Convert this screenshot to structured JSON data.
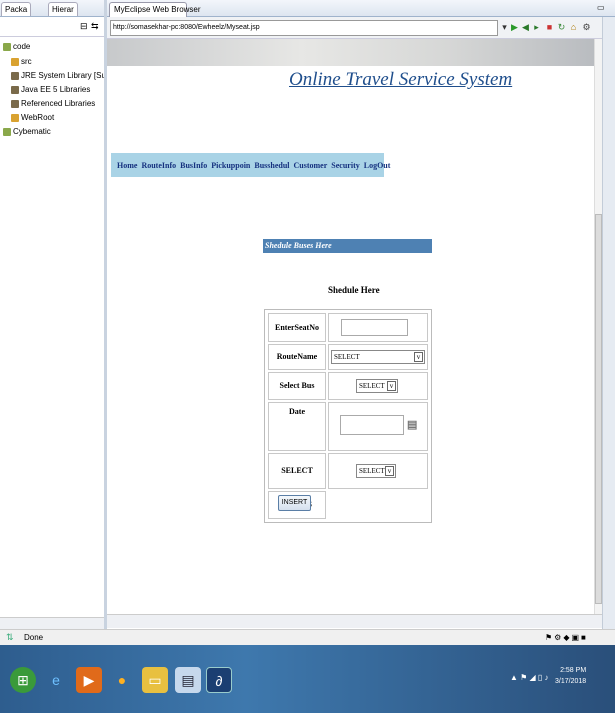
{
  "left_panel": {
    "tabs": [
      {
        "label": "Packa"
      },
      {
        "label": "Hierar"
      }
    ],
    "tree": [
      {
        "label": "code",
        "color": "#8aa84a"
      },
      {
        "label": "src",
        "color": "#d9a230"
      },
      {
        "label": "JRE System Library [Sun J",
        "color": "#7a6a4a"
      },
      {
        "label": "Java EE 5 Libraries",
        "color": "#7a6a4a"
      },
      {
        "label": "Referenced Libraries",
        "color": "#7a6a4a"
      },
      {
        "label": "WebRoot",
        "color": "#d9a230"
      },
      {
        "label": "Cybematic",
        "color": "#8aa84a"
      }
    ]
  },
  "browser": {
    "tab_label": "MyEclipse Web Browser",
    "url": "http://somasekhar-pc:8080/Ewheelz/Myseat.jsp"
  },
  "page": {
    "site_title": "Online Travel Service System",
    "nav": [
      "Home",
      "RouteInfo",
      "BusInfo",
      "Pickuppoin",
      "Busshedul",
      "Customer",
      "Security",
      "LogOut"
    ],
    "section_title": "Shedule Buses Here",
    "form_heading": "Shedule Here",
    "form": {
      "seat_label": "EnterSeatNo",
      "route_label": "RouteName",
      "route_value": "SELECT",
      "bus_label": "Select Bus",
      "bus_value": "SELECT",
      "date_label": "Date",
      "status_label": "SELECT STATUS",
      "status_value": "SELECT",
      "insert_label": "INSERT"
    }
  },
  "status": {
    "text": "Done"
  },
  "taskbar": {
    "time": "2:58 PM",
    "date": "3/17/2018"
  }
}
